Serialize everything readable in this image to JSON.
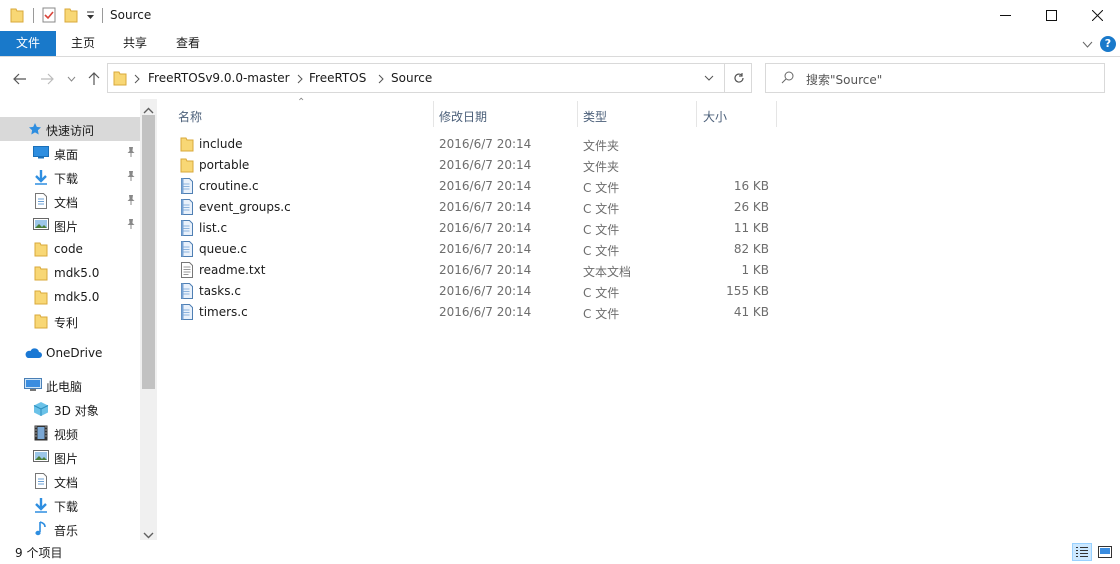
{
  "window": {
    "title": "Source",
    "controls": {
      "minimize": "minimize-icon",
      "maximize": "maximize-icon",
      "close": "close-icon"
    }
  },
  "ribbon": {
    "tabs": [
      "文件",
      "主页",
      "共享",
      "查看"
    ],
    "help": "?"
  },
  "address": {
    "segments": [
      "FreeRTOSv9.0.0-master",
      "FreeRTOS",
      "Source"
    ]
  },
  "search": {
    "placeholder": "搜索\"Source\""
  },
  "sidebar": {
    "quick_access": "快速访问",
    "pinned": [
      "桌面",
      "下载",
      "文档",
      "图片"
    ],
    "folders": [
      "code",
      "mdk5.0",
      "mdk5.0",
      "专利"
    ],
    "onedrive": "OneDrive",
    "this_pc": "此电脑",
    "pc_items": [
      "3D 对象",
      "视频",
      "图片",
      "文档",
      "下载",
      "音乐"
    ]
  },
  "columns": {
    "name": "名称",
    "date": "修改日期",
    "type": "类型",
    "size": "大小"
  },
  "files": [
    {
      "name": "include",
      "date": "2016/6/7 20:14",
      "type": "文件夹",
      "size": "",
      "icon": "folder-icon"
    },
    {
      "name": "portable",
      "date": "2016/6/7 20:14",
      "type": "文件夹",
      "size": "",
      "icon": "folder-icon"
    },
    {
      "name": "croutine.c",
      "date": "2016/6/7 20:14",
      "type": "C 文件",
      "size": "16 KB",
      "icon": "c-file-icon"
    },
    {
      "name": "event_groups.c",
      "date": "2016/6/7 20:14",
      "type": "C 文件",
      "size": "26 KB",
      "icon": "c-file-icon"
    },
    {
      "name": "list.c",
      "date": "2016/6/7 20:14",
      "type": "C 文件",
      "size": "11 KB",
      "icon": "c-file-icon"
    },
    {
      "name": "queue.c",
      "date": "2016/6/7 20:14",
      "type": "C 文件",
      "size": "82 KB",
      "icon": "c-file-icon"
    },
    {
      "name": "readme.txt",
      "date": "2016/6/7 20:14",
      "type": "文本文档",
      "size": "1 KB",
      "icon": "text-file-icon"
    },
    {
      "name": "tasks.c",
      "date": "2016/6/7 20:14",
      "type": "C 文件",
      "size": "155 KB",
      "icon": "c-file-icon"
    },
    {
      "name": "timers.c",
      "date": "2016/6/7 20:14",
      "type": "C 文件",
      "size": "41 KB",
      "icon": "c-file-icon"
    }
  ],
  "status": {
    "item_count": "9 个项目"
  },
  "colors": {
    "accent": "#1979ca",
    "folder": "#f8d775",
    "selected_nav": "#d9d9d9"
  }
}
